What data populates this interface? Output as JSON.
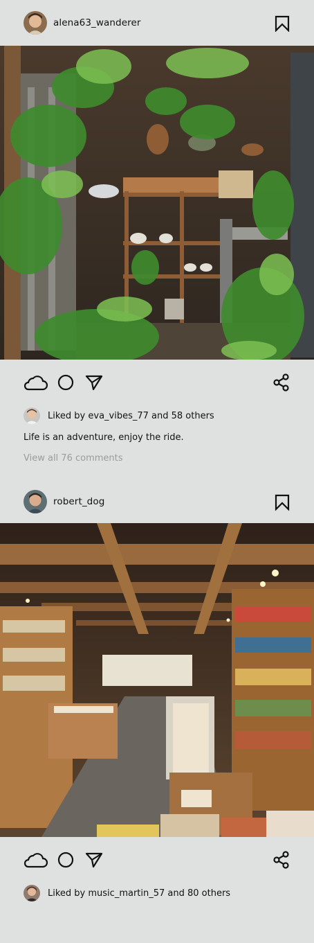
{
  "posts": [
    {
      "username": "alena63_wanderer",
      "liked_by_text": "Liked by eva_vibes_77 and 58 others",
      "caption": "Life is an adventure, enjoy the ride.",
      "view_comments": "View all 76 comments"
    },
    {
      "username": "robert_dog",
      "liked_by_text": "Liked by music_martin_57 and 80 others"
    }
  ],
  "icons": {
    "like": "cloud-icon",
    "comment": "circle-icon",
    "send": "send-icon",
    "share": "share-icon",
    "bookmark": "bookmark-icon"
  },
  "colors": {
    "background": "#dfe1e1",
    "text": "#111111",
    "muted": "#9a9c9c"
  }
}
